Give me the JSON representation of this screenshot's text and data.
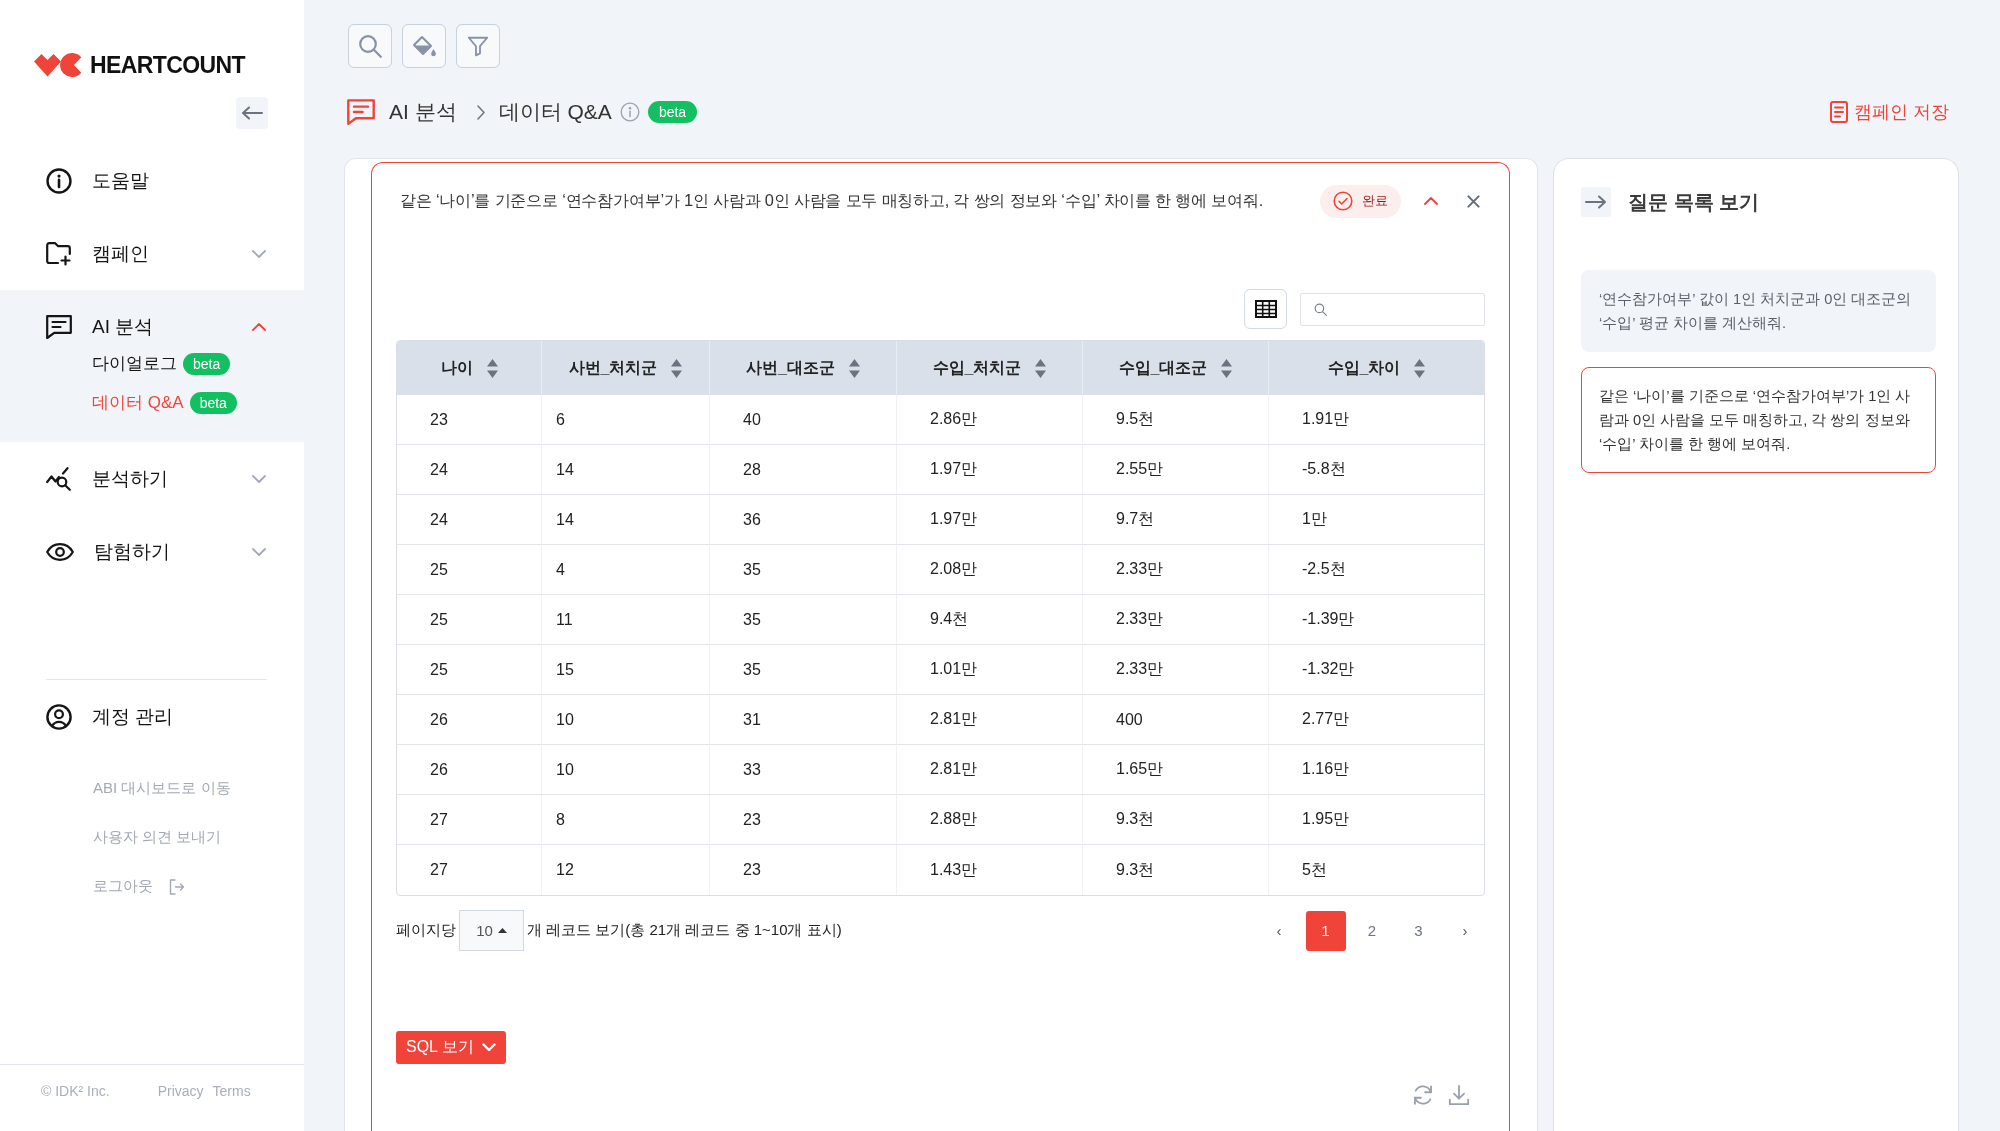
{
  "sidebar": {
    "logo": "HEARTCOUNT",
    "nav": [
      {
        "label": "도움말"
      },
      {
        "label": "캠페인",
        "expanded": false
      },
      {
        "label": "AI 분석",
        "expanded": true,
        "children": [
          {
            "label": "다이얼로그",
            "badge": "beta",
            "selected": false
          },
          {
            "label": "데이터 Q&A",
            "badge": "beta",
            "selected": true
          }
        ]
      },
      {
        "label": "분석하기",
        "expanded": false
      },
      {
        "label": "탐험하기",
        "expanded": false
      }
    ],
    "account": {
      "label": "계정 관리",
      "links": [
        {
          "kind": "link",
          "label": "ABI 대시보드로 이동"
        },
        {
          "kind": "link",
          "label": "사용자 의견 보내기"
        },
        {
          "kind": "logout",
          "label": "로그아웃"
        }
      ]
    },
    "footer": {
      "copyright": "© IDK² Inc.",
      "links": [
        "Privacy",
        "Terms"
      ]
    }
  },
  "breadcrumb": [
    {
      "label": "AI 분석"
    },
    {
      "label": "데이터 Q&A",
      "badge": "beta"
    }
  ],
  "save_button": "캠페인 저장",
  "result": {
    "question": "같은 ‘나이’를 기준으로 ‘연수참가여부’가 1인 사람과 0인 사람을 모두 매칭하고, 각 쌍의 정보와 ‘수입’ 차이를 한 행에 보여줘.",
    "status": "완료",
    "expanded": true,
    "table": {
      "columns": [
        "나이",
        "사번_처치군",
        "사번_대조군",
        "수입_처치군",
        "수입_대조군",
        "수입_차이"
      ],
      "rows": [
        [
          "23",
          "6",
          "40",
          "2.86만",
          "9.5천",
          "1.91만"
        ],
        [
          "24",
          "14",
          "28",
          "1.97만",
          "2.55만",
          "-5.8천"
        ],
        [
          "24",
          "14",
          "36",
          "1.97만",
          "9.7천",
          "1만"
        ],
        [
          "25",
          "4",
          "35",
          "2.08만",
          "2.33만",
          "-2.5천"
        ],
        [
          "25",
          "11",
          "35",
          "9.4천",
          "2.33만",
          "-1.39만"
        ],
        [
          "25",
          "15",
          "35",
          "1.01만",
          "2.33만",
          "-1.32만"
        ],
        [
          "26",
          "10",
          "31",
          "2.81만",
          "400",
          "2.77만"
        ],
        [
          "26",
          "10",
          "33",
          "2.81만",
          "1.65만",
          "1.16만"
        ],
        [
          "27",
          "8",
          "23",
          "2.88만",
          "9.3천",
          "1.95만"
        ],
        [
          "27",
          "12",
          "23",
          "1.43만",
          "9.3천",
          "5천"
        ]
      ]
    },
    "pagination": {
      "per_page_label": "페이지당",
      "per_page": "10",
      "summary": "개 레코드 보기(총 21개 레코드 중 1~10개 표시)",
      "prev": "‹",
      "next": "›",
      "pages": [
        {
          "label": "1",
          "selected": true
        },
        {
          "label": "2",
          "selected": false
        },
        {
          "label": "3",
          "selected": false
        }
      ]
    },
    "sql_button": "SQL 보기"
  },
  "question_list": {
    "title": "질문 목록 보기",
    "items": [
      {
        "text": "‘연수참가여부’ 값이 1인 처치군과 0인 대조군의 ‘수입’ 평균 차이를 계산해줘.",
        "selected": false
      },
      {
        "text": "같은 ‘나이’를 기준으로 ‘연수참가여부’가 1인 사람과 0인 사람을 모두 매칭하고, 각 쌍의 정보와 ‘수입’ 차이를 한 행에 보여줘.",
        "selected": true
      }
    ]
  }
}
